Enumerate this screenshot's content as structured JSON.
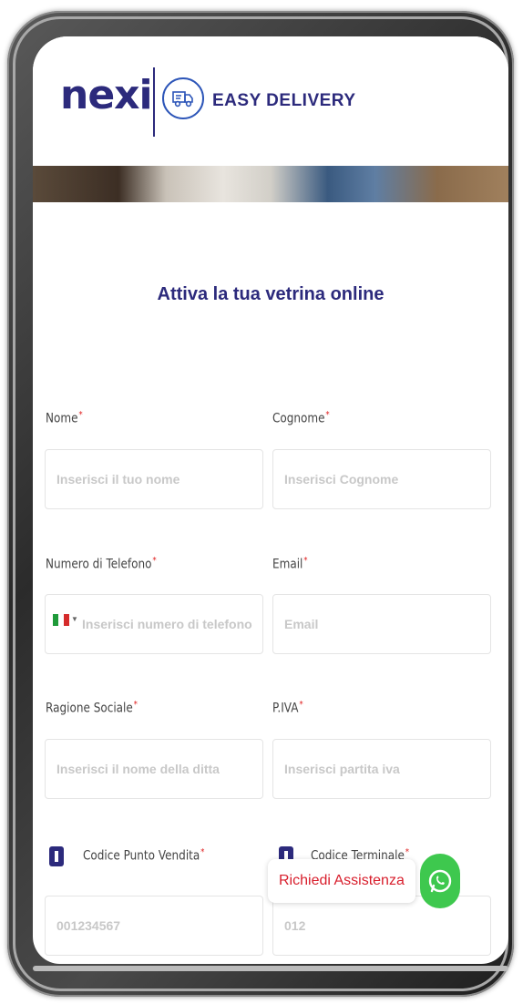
{
  "header": {
    "brand": "nexi",
    "product": "EASY DELIVERY"
  },
  "page_title": "Attiva la tua vetrina online",
  "form": {
    "nome_label": "Nome",
    "nome_placeholder": "Inserisci il tuo nome",
    "cognome_label": "Cognome",
    "cognome_placeholder": "Inserisci Cognome",
    "telefono_label": "Numero di Telefono",
    "telefono_placeholder": "Inserisci numero di telefono",
    "email_label": "Email",
    "email_placeholder": "Email",
    "ragione_label": "Ragione Sociale",
    "ragione_placeholder": "Inserisci il nome della ditta",
    "piva_label": "P.IVA",
    "piva_placeholder": "Inserisci partita iva",
    "codice_pv_label": "Codice Punto Vendita",
    "codice_pv_placeholder": "001234567",
    "codice_term_label": "Codice Terminale",
    "codice_term_placeholder": "012",
    "required_mark": "*"
  },
  "assist": {
    "label": "Richiedi Assistenza"
  },
  "icons": {
    "flag": "italy-flag-icon",
    "info": "info-icon",
    "whatsapp": "whatsapp-icon",
    "truck": "delivery-truck-icon"
  },
  "colors": {
    "brand": "#2c2a7c",
    "required": "#e02020",
    "assist_text": "#d81e2c",
    "whatsapp": "#3ec84e"
  }
}
